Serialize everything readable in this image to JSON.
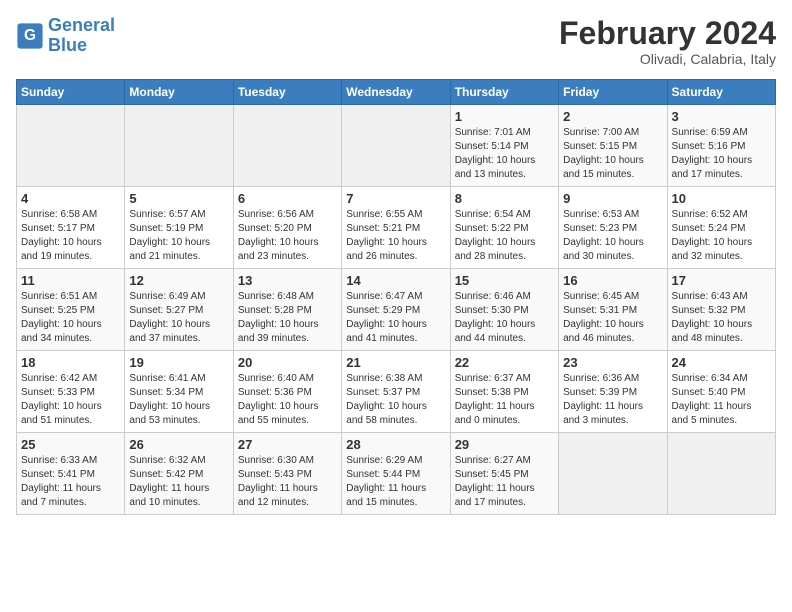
{
  "header": {
    "logo_line1": "General",
    "logo_line2": "Blue",
    "month_title": "February 2024",
    "subtitle": "Olivadi, Calabria, Italy"
  },
  "days_of_week": [
    "Sunday",
    "Monday",
    "Tuesday",
    "Wednesday",
    "Thursday",
    "Friday",
    "Saturday"
  ],
  "weeks": [
    [
      {
        "num": "",
        "info": ""
      },
      {
        "num": "",
        "info": ""
      },
      {
        "num": "",
        "info": ""
      },
      {
        "num": "",
        "info": ""
      },
      {
        "num": "1",
        "info": "Sunrise: 7:01 AM\nSunset: 5:14 PM\nDaylight: 10 hours\nand 13 minutes."
      },
      {
        "num": "2",
        "info": "Sunrise: 7:00 AM\nSunset: 5:15 PM\nDaylight: 10 hours\nand 15 minutes."
      },
      {
        "num": "3",
        "info": "Sunrise: 6:59 AM\nSunset: 5:16 PM\nDaylight: 10 hours\nand 17 minutes."
      }
    ],
    [
      {
        "num": "4",
        "info": "Sunrise: 6:58 AM\nSunset: 5:17 PM\nDaylight: 10 hours\nand 19 minutes."
      },
      {
        "num": "5",
        "info": "Sunrise: 6:57 AM\nSunset: 5:19 PM\nDaylight: 10 hours\nand 21 minutes."
      },
      {
        "num": "6",
        "info": "Sunrise: 6:56 AM\nSunset: 5:20 PM\nDaylight: 10 hours\nand 23 minutes."
      },
      {
        "num": "7",
        "info": "Sunrise: 6:55 AM\nSunset: 5:21 PM\nDaylight: 10 hours\nand 26 minutes."
      },
      {
        "num": "8",
        "info": "Sunrise: 6:54 AM\nSunset: 5:22 PM\nDaylight: 10 hours\nand 28 minutes."
      },
      {
        "num": "9",
        "info": "Sunrise: 6:53 AM\nSunset: 5:23 PM\nDaylight: 10 hours\nand 30 minutes."
      },
      {
        "num": "10",
        "info": "Sunrise: 6:52 AM\nSunset: 5:24 PM\nDaylight: 10 hours\nand 32 minutes."
      }
    ],
    [
      {
        "num": "11",
        "info": "Sunrise: 6:51 AM\nSunset: 5:25 PM\nDaylight: 10 hours\nand 34 minutes."
      },
      {
        "num": "12",
        "info": "Sunrise: 6:49 AM\nSunset: 5:27 PM\nDaylight: 10 hours\nand 37 minutes."
      },
      {
        "num": "13",
        "info": "Sunrise: 6:48 AM\nSunset: 5:28 PM\nDaylight: 10 hours\nand 39 minutes."
      },
      {
        "num": "14",
        "info": "Sunrise: 6:47 AM\nSunset: 5:29 PM\nDaylight: 10 hours\nand 41 minutes."
      },
      {
        "num": "15",
        "info": "Sunrise: 6:46 AM\nSunset: 5:30 PM\nDaylight: 10 hours\nand 44 minutes."
      },
      {
        "num": "16",
        "info": "Sunrise: 6:45 AM\nSunset: 5:31 PM\nDaylight: 10 hours\nand 46 minutes."
      },
      {
        "num": "17",
        "info": "Sunrise: 6:43 AM\nSunset: 5:32 PM\nDaylight: 10 hours\nand 48 minutes."
      }
    ],
    [
      {
        "num": "18",
        "info": "Sunrise: 6:42 AM\nSunset: 5:33 PM\nDaylight: 10 hours\nand 51 minutes."
      },
      {
        "num": "19",
        "info": "Sunrise: 6:41 AM\nSunset: 5:34 PM\nDaylight: 10 hours\nand 53 minutes."
      },
      {
        "num": "20",
        "info": "Sunrise: 6:40 AM\nSunset: 5:36 PM\nDaylight: 10 hours\nand 55 minutes."
      },
      {
        "num": "21",
        "info": "Sunrise: 6:38 AM\nSunset: 5:37 PM\nDaylight: 10 hours\nand 58 minutes."
      },
      {
        "num": "22",
        "info": "Sunrise: 6:37 AM\nSunset: 5:38 PM\nDaylight: 11 hours\nand 0 minutes."
      },
      {
        "num": "23",
        "info": "Sunrise: 6:36 AM\nSunset: 5:39 PM\nDaylight: 11 hours\nand 3 minutes."
      },
      {
        "num": "24",
        "info": "Sunrise: 6:34 AM\nSunset: 5:40 PM\nDaylight: 11 hours\nand 5 minutes."
      }
    ],
    [
      {
        "num": "25",
        "info": "Sunrise: 6:33 AM\nSunset: 5:41 PM\nDaylight: 11 hours\nand 7 minutes."
      },
      {
        "num": "26",
        "info": "Sunrise: 6:32 AM\nSunset: 5:42 PM\nDaylight: 11 hours\nand 10 minutes."
      },
      {
        "num": "27",
        "info": "Sunrise: 6:30 AM\nSunset: 5:43 PM\nDaylight: 11 hours\nand 12 minutes."
      },
      {
        "num": "28",
        "info": "Sunrise: 6:29 AM\nSunset: 5:44 PM\nDaylight: 11 hours\nand 15 minutes."
      },
      {
        "num": "29",
        "info": "Sunrise: 6:27 AM\nSunset: 5:45 PM\nDaylight: 11 hours\nand 17 minutes."
      },
      {
        "num": "",
        "info": ""
      },
      {
        "num": "",
        "info": ""
      }
    ]
  ]
}
